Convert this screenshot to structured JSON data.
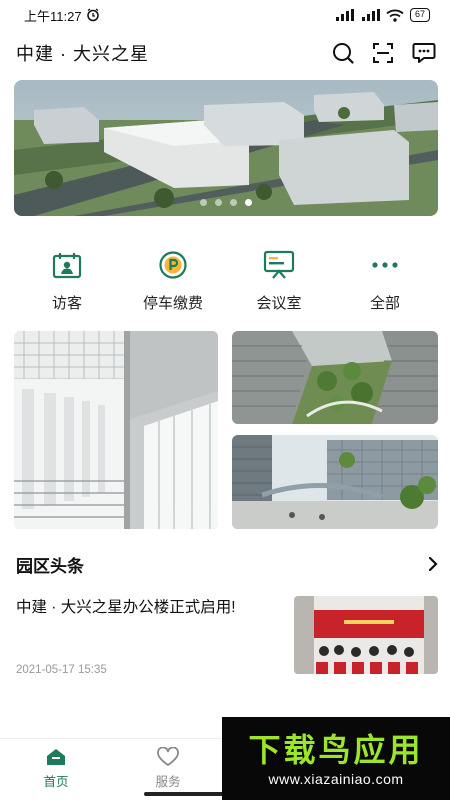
{
  "status_bar": {
    "time": "上午11:27",
    "battery": "67"
  },
  "header": {
    "title": "中建 · 大兴之星"
  },
  "banner": {
    "slide_count": 4,
    "active_index": 3
  },
  "quick_menu": {
    "items": [
      {
        "label": "访客",
        "icon": "visitor-icon"
      },
      {
        "label": "停车缴费",
        "icon": "parking-icon"
      },
      {
        "label": "会议室",
        "icon": "meeting-room-icon"
      },
      {
        "label": "全部",
        "icon": "more-icon"
      }
    ]
  },
  "news": {
    "section_title": "园区头条",
    "items": [
      {
        "headline": "中建 · 大兴之星办公楼正式启用!",
        "date": "2021-05-17 15:35"
      }
    ]
  },
  "bottom_nav": {
    "items": [
      {
        "label": "首页",
        "icon": "home-icon",
        "active": true
      },
      {
        "label": "服务",
        "icon": "heart-icon",
        "active": false
      }
    ]
  },
  "watermark": {
    "brand": "下载鸟应用",
    "url": "www.xiazainiao.com"
  },
  "colors": {
    "accent": "#1d7a5a",
    "watermark_green": "#9be52b"
  }
}
